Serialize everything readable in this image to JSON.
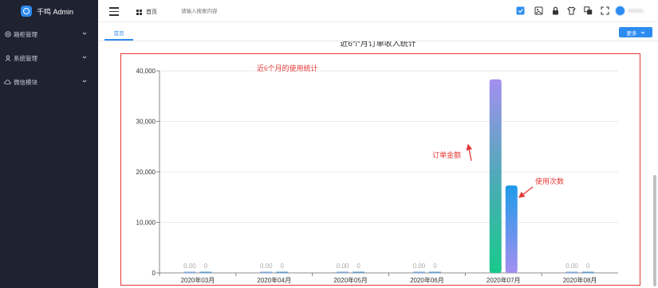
{
  "app": {
    "title": "千鸣 Admin"
  },
  "sidebar": {
    "items": [
      {
        "label": "箱柜管理",
        "icon": "cabinet-icon"
      },
      {
        "label": "系统管理",
        "icon": "user-icon"
      },
      {
        "label": "微信模块",
        "icon": "cloud-icon"
      }
    ]
  },
  "header": {
    "breadcrumb": "首页",
    "search_placeholder": "请输入搜索内容",
    "tools": [
      "notification-icon",
      "image-icon",
      "lock-icon",
      "shirt-icon",
      "translate-icon",
      "fullscreen-icon"
    ]
  },
  "tabs": {
    "home": "首页",
    "more": "更多"
  },
  "chart_title": "近6个月订单收入统计",
  "annotations": {
    "chart_note": "近6个月的使用统计",
    "order_amount": "订单金额",
    "usage_count": "使用次数"
  },
  "colors": {
    "accent": "#2d8cf0",
    "annotation": "#e53935",
    "sidebar": "#1f2230"
  },
  "chart_data": {
    "type": "bar",
    "categories": [
      "2020年03月",
      "2020年04月",
      "2020年05月",
      "2020年06月",
      "2020年07月",
      "2020年08月"
    ],
    "series": [
      {
        "values": [
          0,
          0,
          0,
          0,
          38300,
          0
        ],
        "labels": [
          "0.00",
          "0.00",
          "0.00",
          "0.00",
          "",
          "0.00"
        ]
      },
      {
        "values": [
          0,
          0,
          0,
          0,
          17300,
          0
        ],
        "labels": [
          "0",
          "0",
          "0",
          "0",
          "",
          "0"
        ]
      }
    ],
    "yticks": [
      "0",
      "10,000",
      "20,000",
      "30,000",
      "40,000"
    ],
    "ylim": [
      0,
      40000
    ],
    "grid": true
  }
}
